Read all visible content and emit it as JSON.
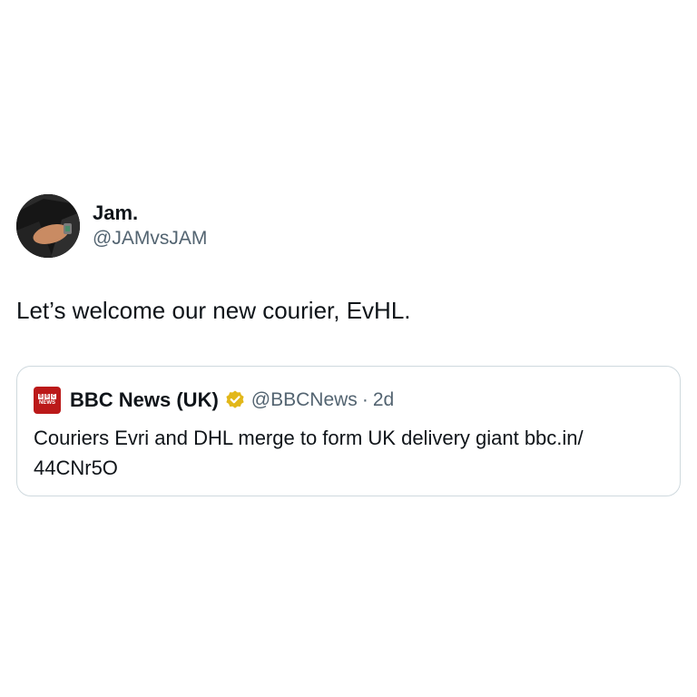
{
  "tweet": {
    "author": {
      "display_name": "Jam.",
      "handle": "@JAMvsJAM",
      "avatar_icon": "avatar-photo"
    },
    "text": "Let’s welcome our new courier, EvHL."
  },
  "quoted_tweet": {
    "author": {
      "logo_icon": "bbc-news-logo",
      "logo_blocks": [
        "B",
        "B",
        "C"
      ],
      "logo_word": "NEWS",
      "display_name": "BBC News (UK)",
      "verified_icon": "gold-verified-badge-icon",
      "handle": "@BBCNews",
      "separator": "·",
      "time": "2d"
    },
    "text_line1": "Couriers Evri and DHL merge to form UK delivery giant bbc.in/",
    "text_line2": "44CNr5O"
  },
  "colors": {
    "primary_text": "#0f1419",
    "secondary_text": "#536471",
    "border": "#cfd9de",
    "bbc_red": "#bb1919",
    "verified_gold": "#e2b719"
  }
}
